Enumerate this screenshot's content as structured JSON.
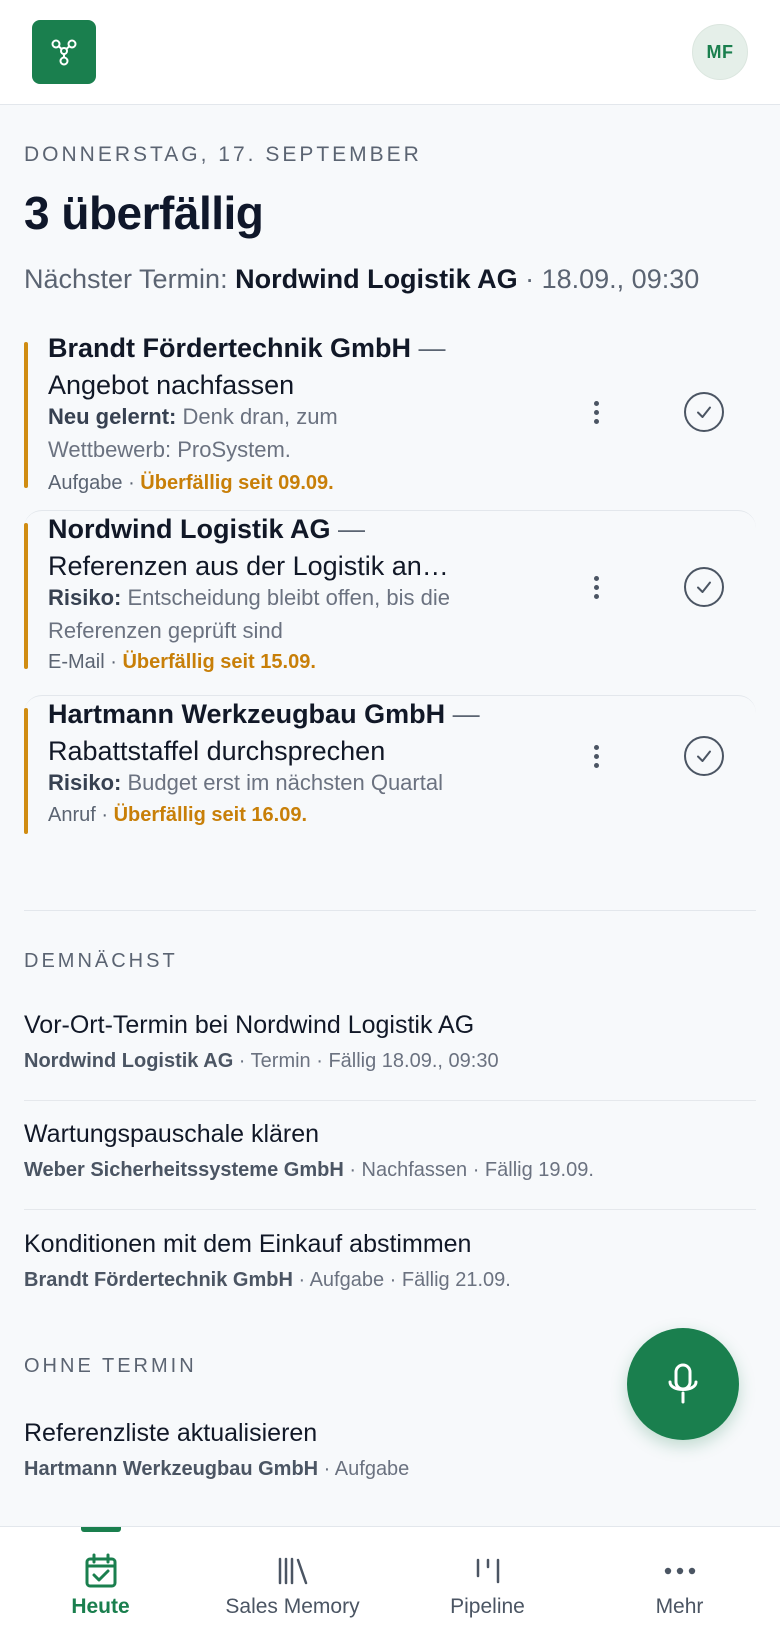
{
  "app": {
    "avatar_initials": "MF",
    "brand_color": "#1a7f4e",
    "warning_color": "#d08c12"
  },
  "summary": {
    "date": "DONNERSTAG, 17. SEPTEMBER",
    "headline": "3 überfällig",
    "next_label": "Nächster Termin:",
    "next_company": "Nordwind Logistik AG",
    "next_time": "· 18.09., 09:30"
  },
  "overdue": [
    {
      "company": "Brandt Fördertechnik GmbH",
      "dash": " —",
      "action": "Angebot nachfassen",
      "note_label": "Neu gelernt:",
      "note_text": " Denk dran, zum Wettbewerb: ProSystem.",
      "type": "Aufgabe",
      "sep": " · ",
      "due": "Überfällig seit 09.09."
    },
    {
      "company": "Nordwind Logistik AG",
      "dash": " —",
      "action": "Referenzen aus der Logistik an…",
      "note_label": "Risiko:",
      "note_text": " Entscheidung bleibt offen, bis die Referenzen geprüft sind",
      "type": "E-Mail",
      "sep": " · ",
      "due": "Überfällig seit 15.09."
    },
    {
      "company": "Hartmann Werkzeugbau GmbH",
      "dash": " —",
      "action": "Rabattstaffel durchsprechen",
      "note_label": "Risiko:",
      "note_text": " Budget erst im nächsten Quartal",
      "type": "Anruf",
      "sep": " · ",
      "due": "Überfällig seit 16.09."
    }
  ],
  "upcoming": {
    "label": "DEMNÄCHST",
    "items": [
      {
        "title": "Vor-Ort-Termin bei Nordwind Logistik AG",
        "company": "Nordwind Logistik AG",
        "detail": " · Termin · Fällig 18.09., 09:30"
      },
      {
        "title": "Wartungspauschale klären",
        "company": "Weber Sicherheitssysteme GmbH",
        "detail": " · Nachfassen · Fällig 19.09."
      },
      {
        "title": "Konditionen mit dem Einkauf abstimmen",
        "company": "Brandt Fördertechnik GmbH",
        "detail": " · Aufgabe · Fällig 21.09."
      }
    ]
  },
  "no_date": {
    "label": "OHNE TERMIN",
    "items": [
      {
        "title": "Referenzliste aktualisieren",
        "company": "Hartmann Werkzeugbau GmbH",
        "detail": " · Aufgabe"
      }
    ]
  },
  "fab": {
    "icon": "microphone-icon"
  },
  "tabs": [
    {
      "label": "Heute",
      "icon": "calendar-check-icon",
      "active": true
    },
    {
      "label": "Sales Memory",
      "icon": "library-icon",
      "active": false
    },
    {
      "label": "Pipeline",
      "icon": "pipeline-icon",
      "active": false
    },
    {
      "label": "Mehr",
      "icon": "more-icon",
      "active": false
    }
  ]
}
